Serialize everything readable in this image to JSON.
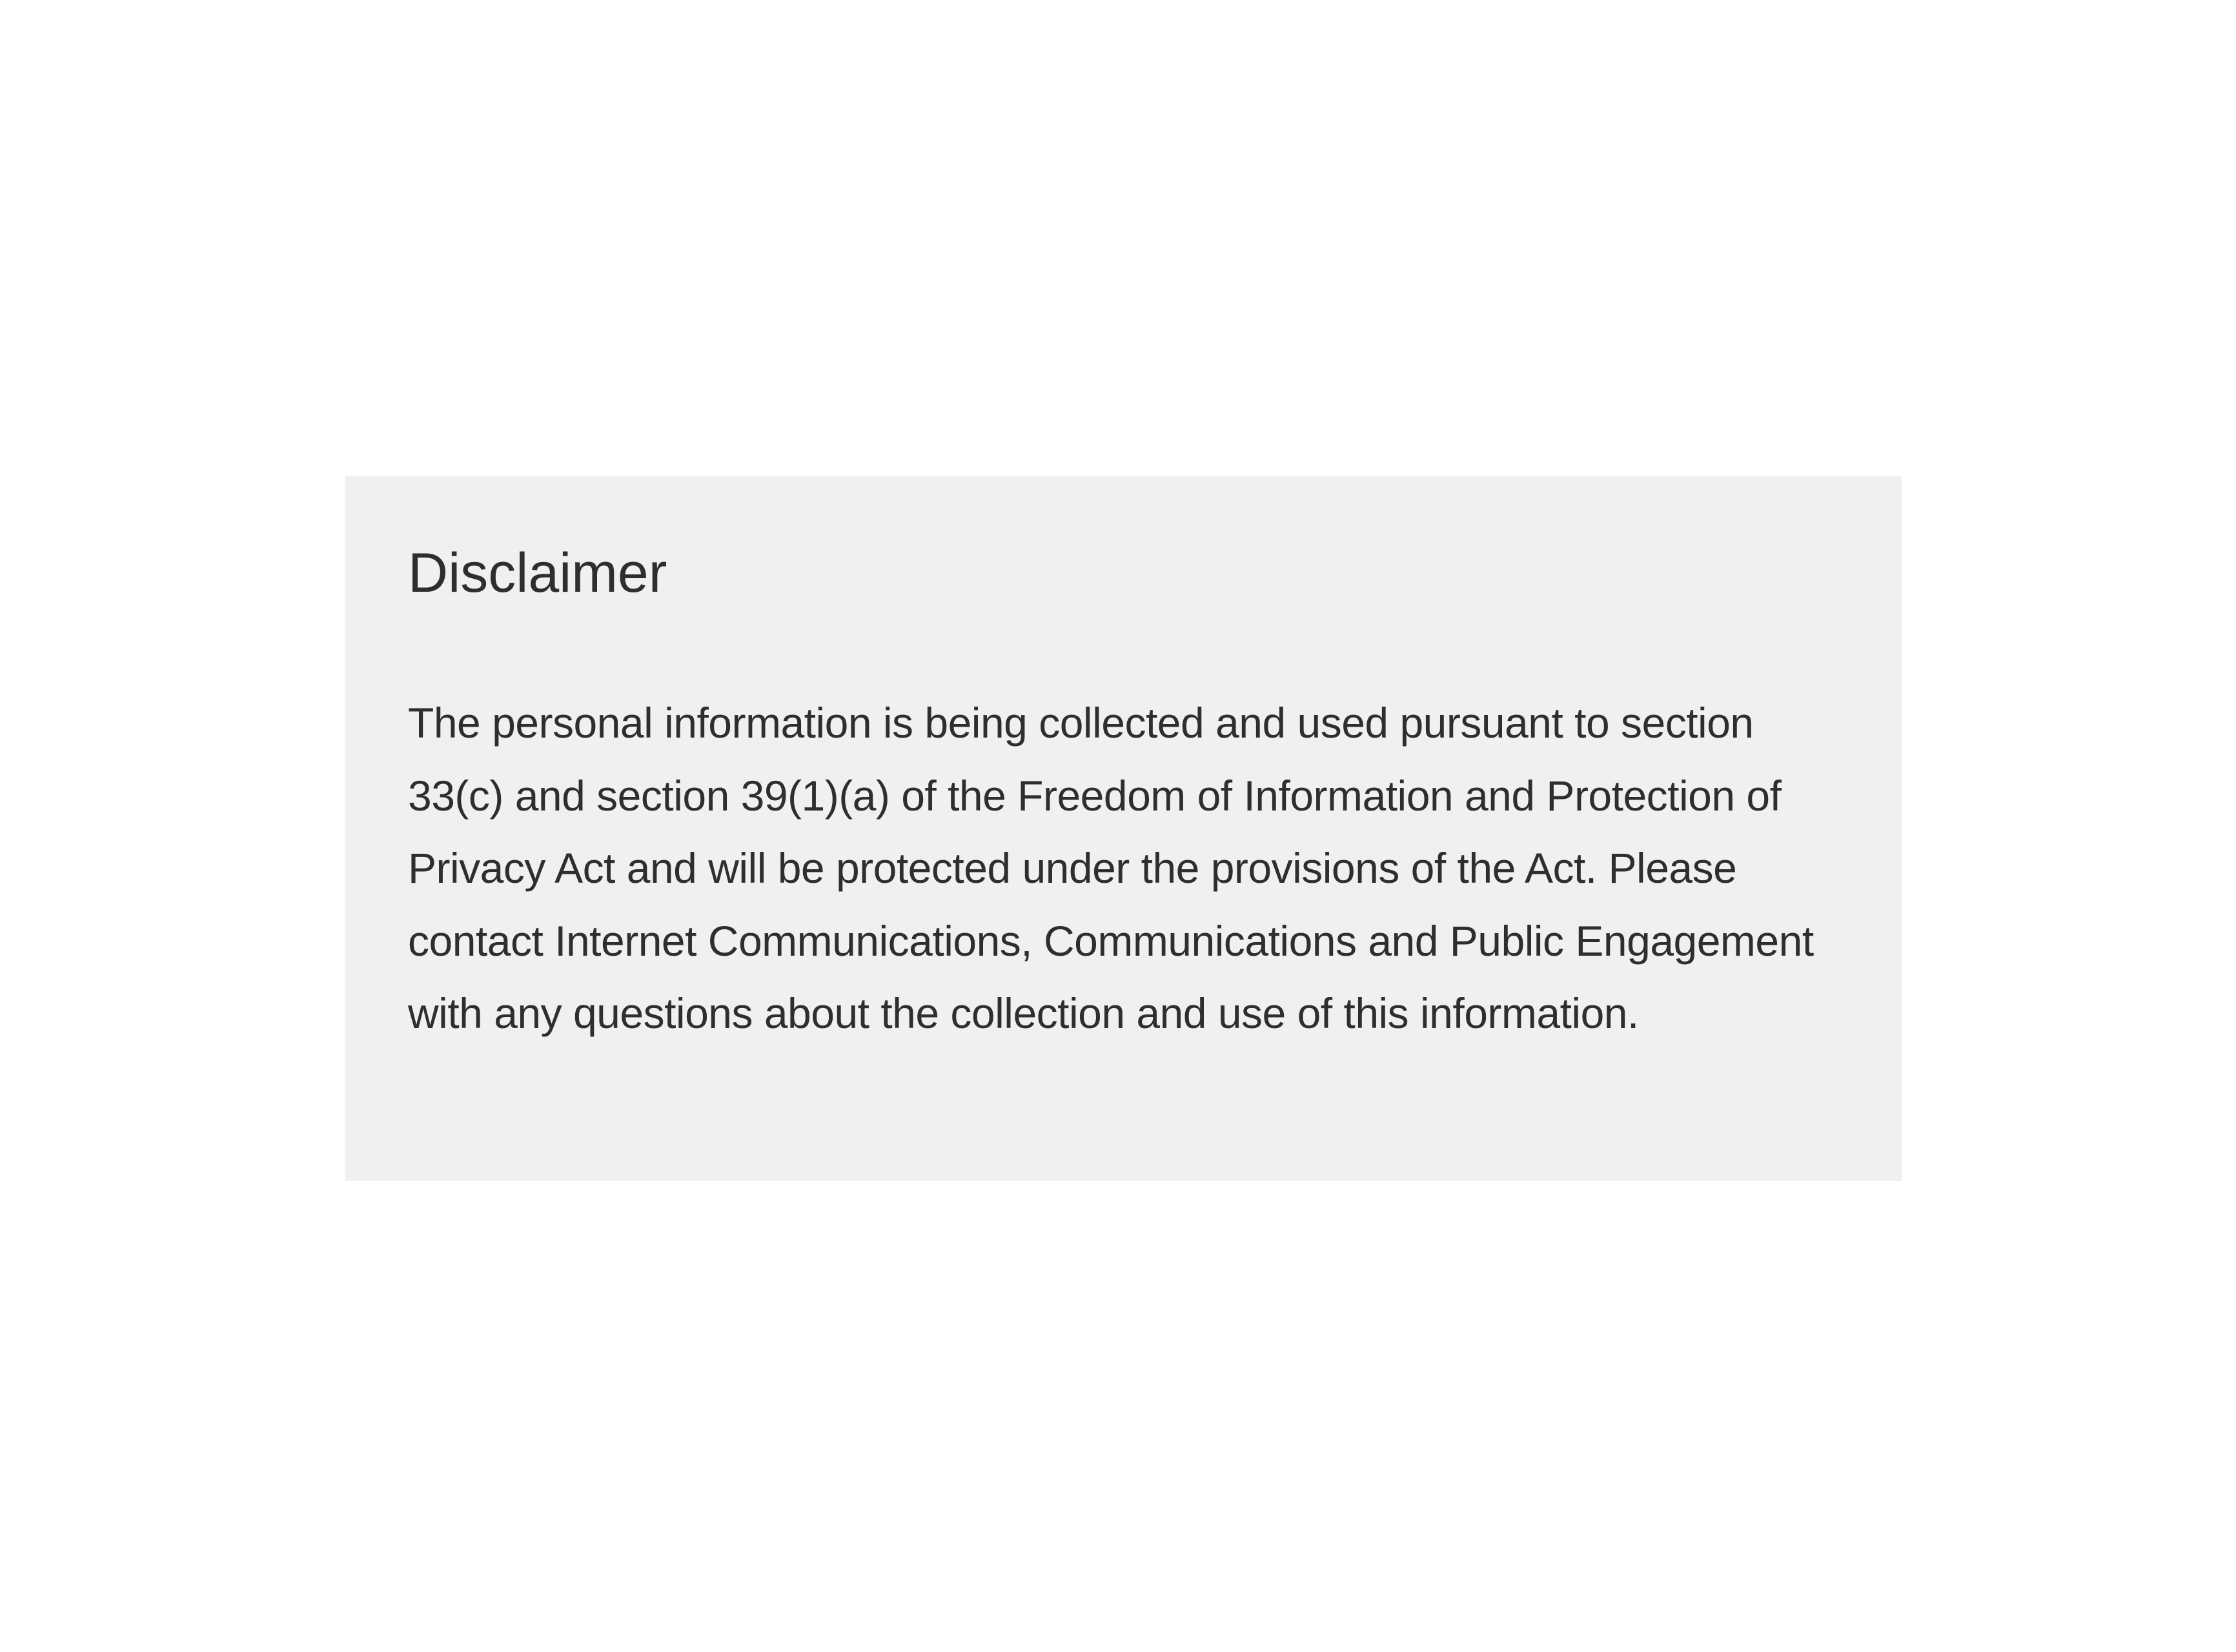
{
  "disclaimer": {
    "title": "Disclaimer",
    "body": "The personal information is being collected and used pursuant to section 33(c) and section 39(1)(a) of the Freedom of Information and Protection of Privacy Act and will be protected under the provisions of the Act. Please contact Internet Communications, Communications and Public Engagement with any questions about the collection and use of this information."
  },
  "colors": {
    "page_background": "#ffffff",
    "panel_background": "#f0f0f0",
    "text": "#2e2e2e"
  }
}
